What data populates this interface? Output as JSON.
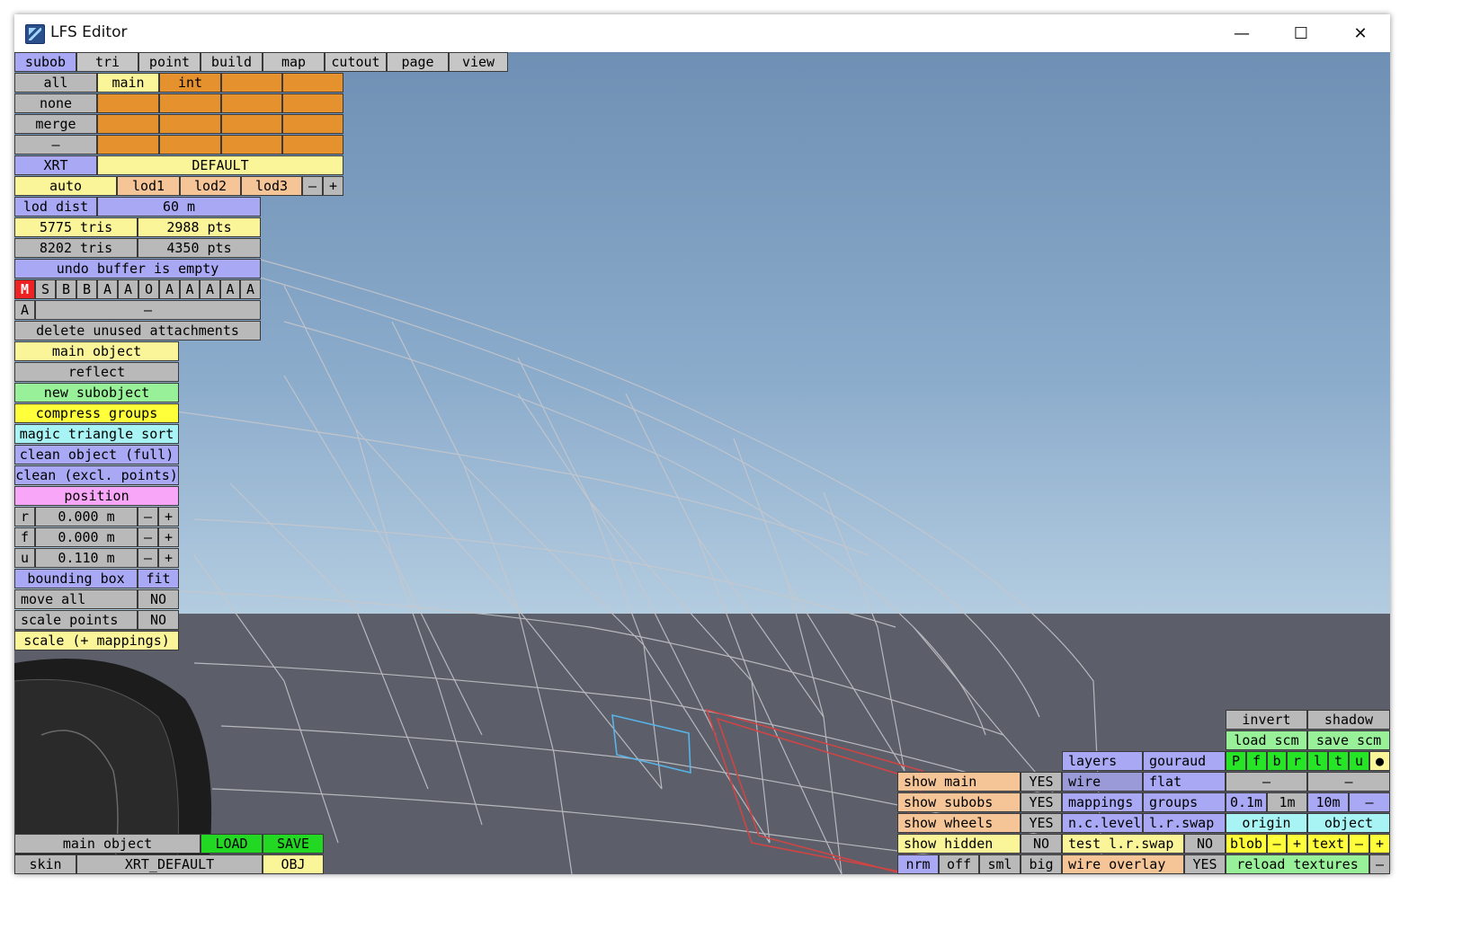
{
  "window": {
    "title": "LFS Editor",
    "minimize": "—",
    "maximize": "☐",
    "close": "✕"
  },
  "tabs": [
    "subob",
    "tri",
    "point",
    "build",
    "map",
    "cutout",
    "page",
    "view"
  ],
  "subob": {
    "all": "all",
    "none": "none",
    "merge": "merge",
    "dash": "–",
    "main": "main",
    "int": "int",
    "xrt": "XRT",
    "default": "DEFAULT",
    "auto": "auto",
    "lod1": "lod1",
    "lod2": "lod2",
    "lod3": "lod3",
    "minus": "–",
    "plus": "+",
    "lod_dist_label": "lod dist",
    "lod_dist_value": "60 m",
    "tris1": "5775 tris",
    "pts1": "2988 pts",
    "tris2": "8202 tris",
    "pts2": "4350 pts",
    "undo": "undo buffer is empty",
    "attach_row": [
      "M",
      "S",
      "B",
      "B",
      "A",
      "A",
      "O",
      "A",
      "A",
      "A",
      "A",
      "A"
    ],
    "attach_a": "A",
    "attach_dash": "–",
    "delete_unused": "delete unused attachments"
  },
  "object_menu": {
    "main_object": "main object",
    "reflect": "reflect",
    "new_subobject": "new subobject",
    "compress_groups": "compress groups",
    "magic_sort": "magic triangle sort",
    "clean_full": "clean object (full)",
    "clean_excl": "clean (excl. points)",
    "position": "position",
    "pos_rows": [
      {
        "axis": "r",
        "value": "0.000 m"
      },
      {
        "axis": "f",
        "value": "0.000 m"
      },
      {
        "axis": "u",
        "value": "0.110 m"
      }
    ],
    "minus": "–",
    "plus": "+",
    "bounding_box": "bounding box",
    "fit": "fit",
    "move_all": "move all",
    "move_all_value": "NO",
    "scale_points": "scale points",
    "scale_points_value": "NO",
    "scale_mappings": "scale (+ mappings)"
  },
  "bottom_left": {
    "main_object": "main object",
    "load": "LOAD",
    "save": "SAVE",
    "skin": "skin",
    "xrt_default": "XRT_DEFAULT",
    "obj": "OBJ"
  },
  "show_panel": {
    "rows": [
      {
        "label": "show main",
        "value": "YES"
      },
      {
        "label": "show subobs",
        "value": "YES"
      },
      {
        "label": "show wheels",
        "value": "YES"
      },
      {
        "label": "show hidden",
        "value": "NO"
      }
    ],
    "nrm": "nrm",
    "off": "off",
    "sml": "sml",
    "big": "big"
  },
  "render_panel": {
    "layers": "layers",
    "gouraud": "gouraud",
    "wire": "wire",
    "flat": "flat",
    "mappings": "mappings",
    "groups": "groups",
    "nc_level": "n.c.level",
    "lr_swap": "l.r.swap",
    "test_lr_swap": "test l.r.swap",
    "test_lr_value": "NO",
    "wire_overlay": "wire overlay",
    "wire_overlay_value": "YES"
  },
  "view_panel": {
    "invert": "invert",
    "shadow": "shadow",
    "load_scm": "load scm",
    "save_scm": "save scm",
    "views": [
      "P",
      "f",
      "b",
      "r",
      "l",
      "t",
      "u",
      "●"
    ],
    "dash": "–",
    "grid": [
      "0.1m",
      "1m",
      "10m",
      "–"
    ],
    "origin": "origin",
    "object": "object",
    "blob": "blob",
    "text": "text",
    "minus": "–",
    "plus": "+",
    "reload": "reload textures"
  }
}
